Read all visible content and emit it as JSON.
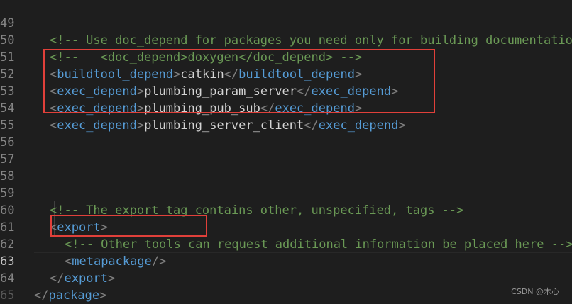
{
  "editor": {
    "lines": [
      {
        "num": "49",
        "text": "<!-- Use doc_depend for packages you need only for building documentation: -->"
      },
      {
        "num": "50",
        "text": "<!--   <doc_depend>doxygen</doc_depend> -->"
      },
      {
        "num": "51",
        "open": "buildtool_depend",
        "content": "catkin",
        "close": "buildtool_depend"
      },
      {
        "num": "52",
        "open": "exec_depend",
        "content": "plumbing_param_server",
        "close": "exec_depend"
      },
      {
        "num": "53",
        "open": "exec_depend",
        "content": "plumbing_pub_sub",
        "close": "exec_depend"
      },
      {
        "num": "54",
        "open": "exec_depend",
        "content": "plumbing_server_client",
        "close": "exec_depend"
      },
      {
        "num": "55",
        "text": ""
      },
      {
        "num": "56",
        "text": ""
      },
      {
        "num": "57",
        "text": ""
      },
      {
        "num": "58",
        "text": ""
      },
      {
        "num": "59",
        "text": "<!-- The export tag contains other, unspecified, tags -->"
      },
      {
        "num": "60",
        "open": "export"
      },
      {
        "num": "61",
        "text": "<!-- Other tools can request additional information be placed here -->"
      },
      {
        "num": "62",
        "selfclose": "metapackage"
      },
      {
        "num": "63",
        "close": "export"
      },
      {
        "num": "64",
        "close": "package"
      },
      {
        "num": "65",
        "text": ""
      }
    ]
  },
  "watermark": "CSDN @木心",
  "colors": {
    "background": "#1e1e1e",
    "comment": "#6a9955",
    "tag": "#569cd6",
    "text": "#d4d4d4",
    "highlight": "#e0403a"
  }
}
